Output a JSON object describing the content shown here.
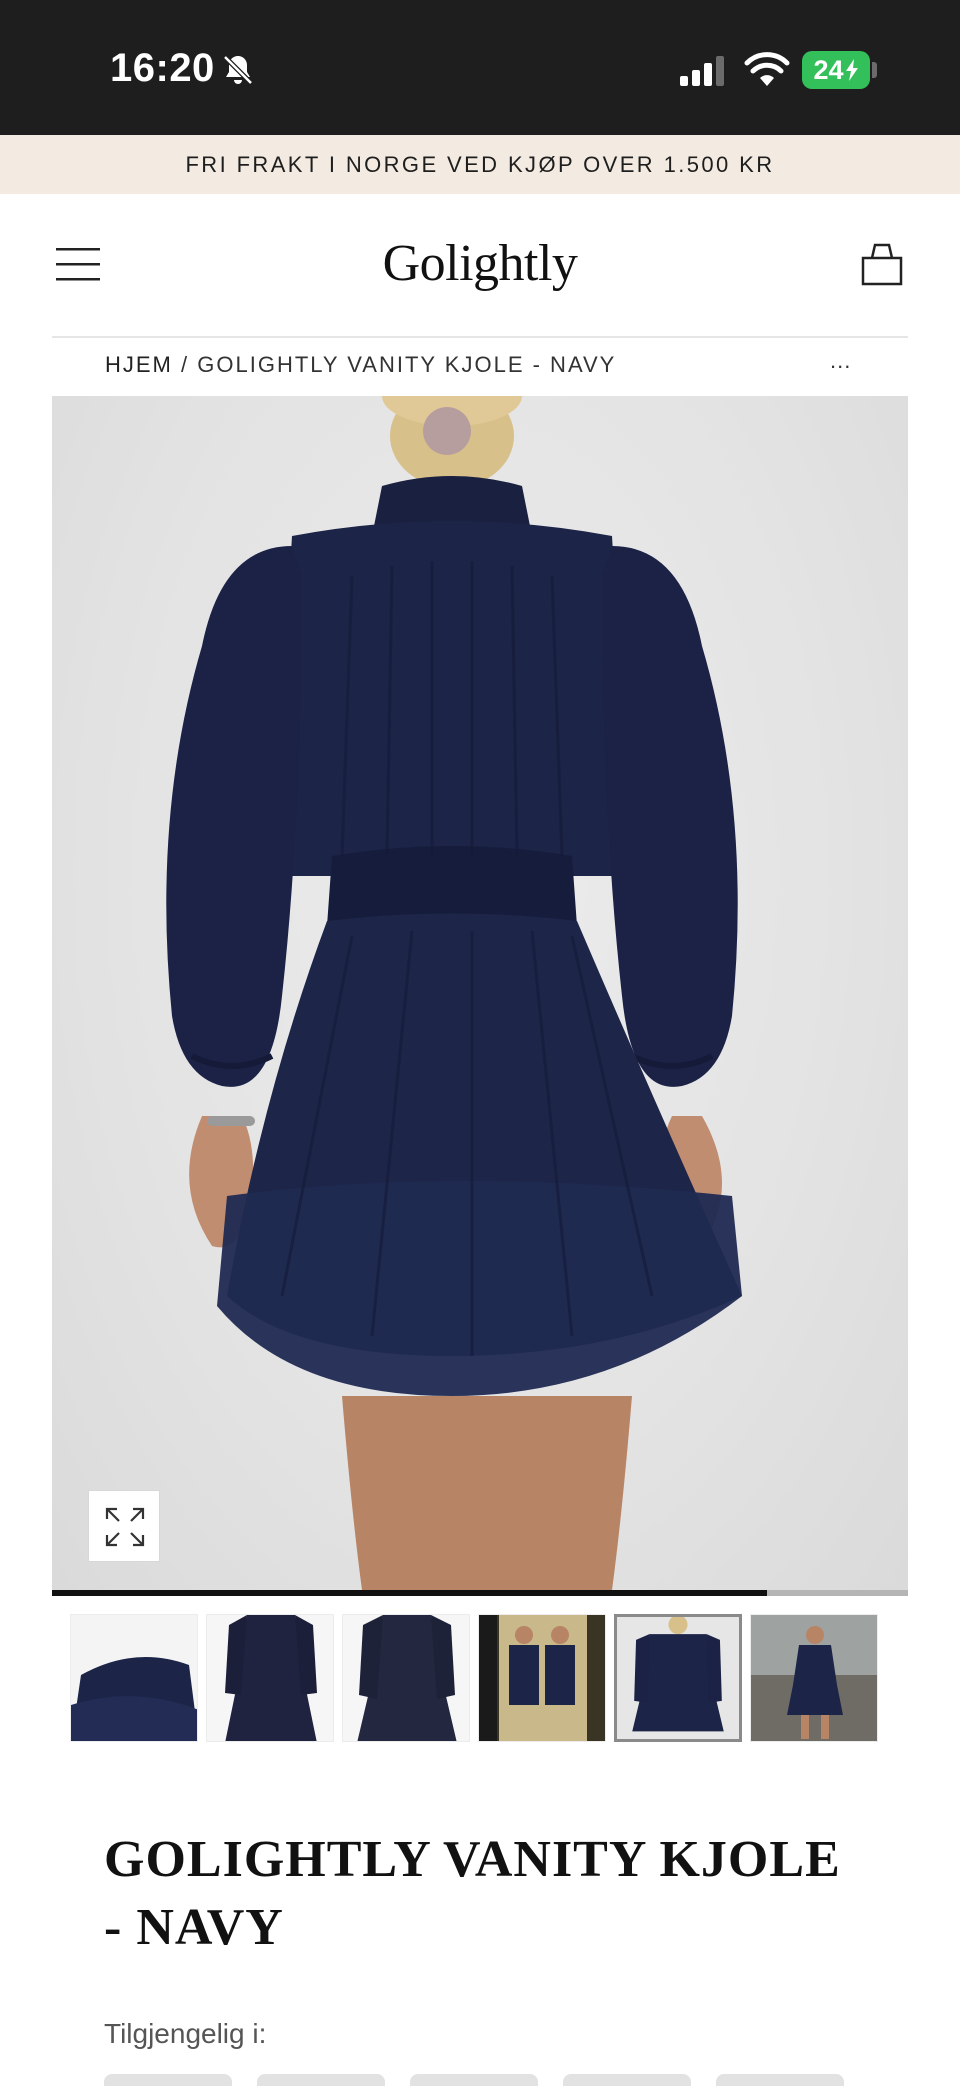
{
  "status_bar": {
    "time": "16:20",
    "battery": "24"
  },
  "promo": {
    "text": "FRI FRAKT I NORGE VED KJØP OVER 1.500 KR"
  },
  "header": {
    "logo": "Golightly"
  },
  "breadcrumb": {
    "home": "HJEM",
    "separator": "/",
    "current": "GOLIGHTLY VANITY KJOLE - NAVY",
    "more": "..."
  },
  "gallery": {
    "progress": 0.835,
    "thumbnail_count": 6,
    "active_thumbnail": 5
  },
  "product": {
    "title": "GOLIGHTLY VANITY KJOLE - NAVY",
    "available_label": "Tilgjengelig i:"
  },
  "colors": {
    "navy": "#1c2447",
    "banner_bg": "#f3ebe1",
    "battery_green": "#33c05a"
  },
  "icons": [
    "bell-off-icon",
    "signal-icon",
    "wifi-icon",
    "menu-icon",
    "bag-icon",
    "expand-icon"
  ]
}
